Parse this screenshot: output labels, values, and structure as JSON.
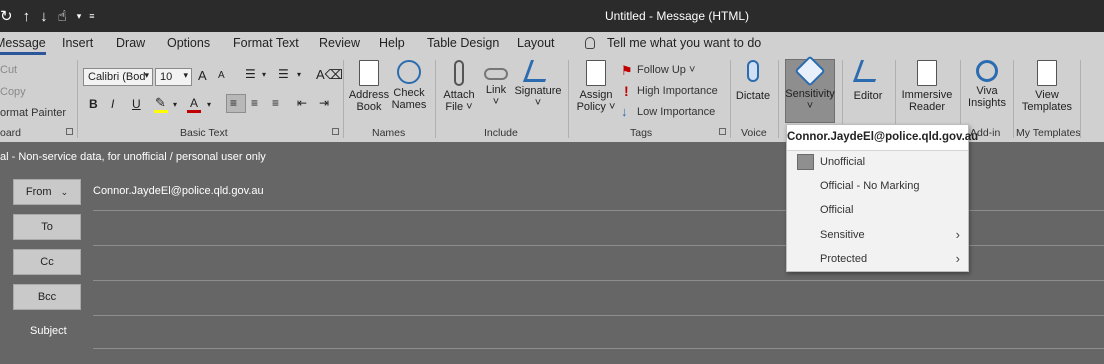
{
  "window": {
    "title": "Untitled  -  Message (HTML)"
  },
  "qat": {
    "undo": "↻",
    "up": "↑",
    "down": "↓",
    "touch": "☝",
    "more": "▾",
    "customize": "≡"
  },
  "tabs": [
    "Message",
    "Insert",
    "Draw",
    "Options",
    "Format Text",
    "Review",
    "Help",
    "Table Design",
    "Layout"
  ],
  "tell_me": "Tell me what you want to do",
  "clipboard": {
    "cut": "Cut",
    "copy": "Copy",
    "format_painter": "ormat Painter",
    "label": "oard"
  },
  "basic_text": {
    "font_name": "Calibri (Bod",
    "font_size": "10",
    "grow": "A",
    "shrink": "A",
    "bold": "B",
    "italic": "I",
    "underline": "U",
    "label": "Basic Text"
  },
  "names": {
    "address_book_1": "Address",
    "address_book_2": "Book",
    "check_names_1": "Check",
    "check_names_2": "Names",
    "label": "Names"
  },
  "include": {
    "attach_1": "Attach",
    "attach_2": "File ˅",
    "link_1": "Link",
    "link_2": "˅",
    "signature_1": "Signature",
    "signature_2": "˅",
    "label": "Include"
  },
  "tags": {
    "assign_1": "Assign",
    "assign_2": "Policy ˅",
    "follow_up": "Follow Up ˅",
    "high": "High Importance",
    "low": "Low Importance",
    "label": "Tags"
  },
  "voice": {
    "dictate": "Dictate",
    "label": "Voice"
  },
  "sensitivity": {
    "label": "Sensitivity",
    "arrow": "˅"
  },
  "editor": {
    "label": "Editor"
  },
  "immersive": {
    "line1": "Immersive",
    "line2": "Reader"
  },
  "viva": {
    "line1": "Viva",
    "line2": "Insights"
  },
  "addin": {
    "label": "Add-in"
  },
  "templates": {
    "line1": "View",
    "line2": "Templates",
    "group": "My Templates"
  },
  "info_band": "al - Non-service data, for unofficial / personal user only",
  "compose": {
    "from_label": "From",
    "from_value": "Connor.JaydeEl@police.qld.gov.au",
    "to_label": "To",
    "cc_label": "Cc",
    "bcc_label": "Bcc",
    "subject_label": "Subject"
  },
  "sensitivity_menu": {
    "account": "Connor.JaydeEl@police.qld.gov.au",
    "items": [
      {
        "label": "Unofficial",
        "selected": true
      },
      {
        "label": "Official - No Marking"
      },
      {
        "label": "Official"
      },
      {
        "label": "Sensitive",
        "submenu": true
      },
      {
        "label": "Protected",
        "submenu": true
      }
    ],
    "chevron": "›"
  },
  "colors": {
    "accent": "#2b579a",
    "ribbon": "#d0d0d0",
    "titlebar": "#2b2b2b",
    "body": "#666666",
    "highlight": "#ffff00",
    "font_color": "#c00000"
  }
}
